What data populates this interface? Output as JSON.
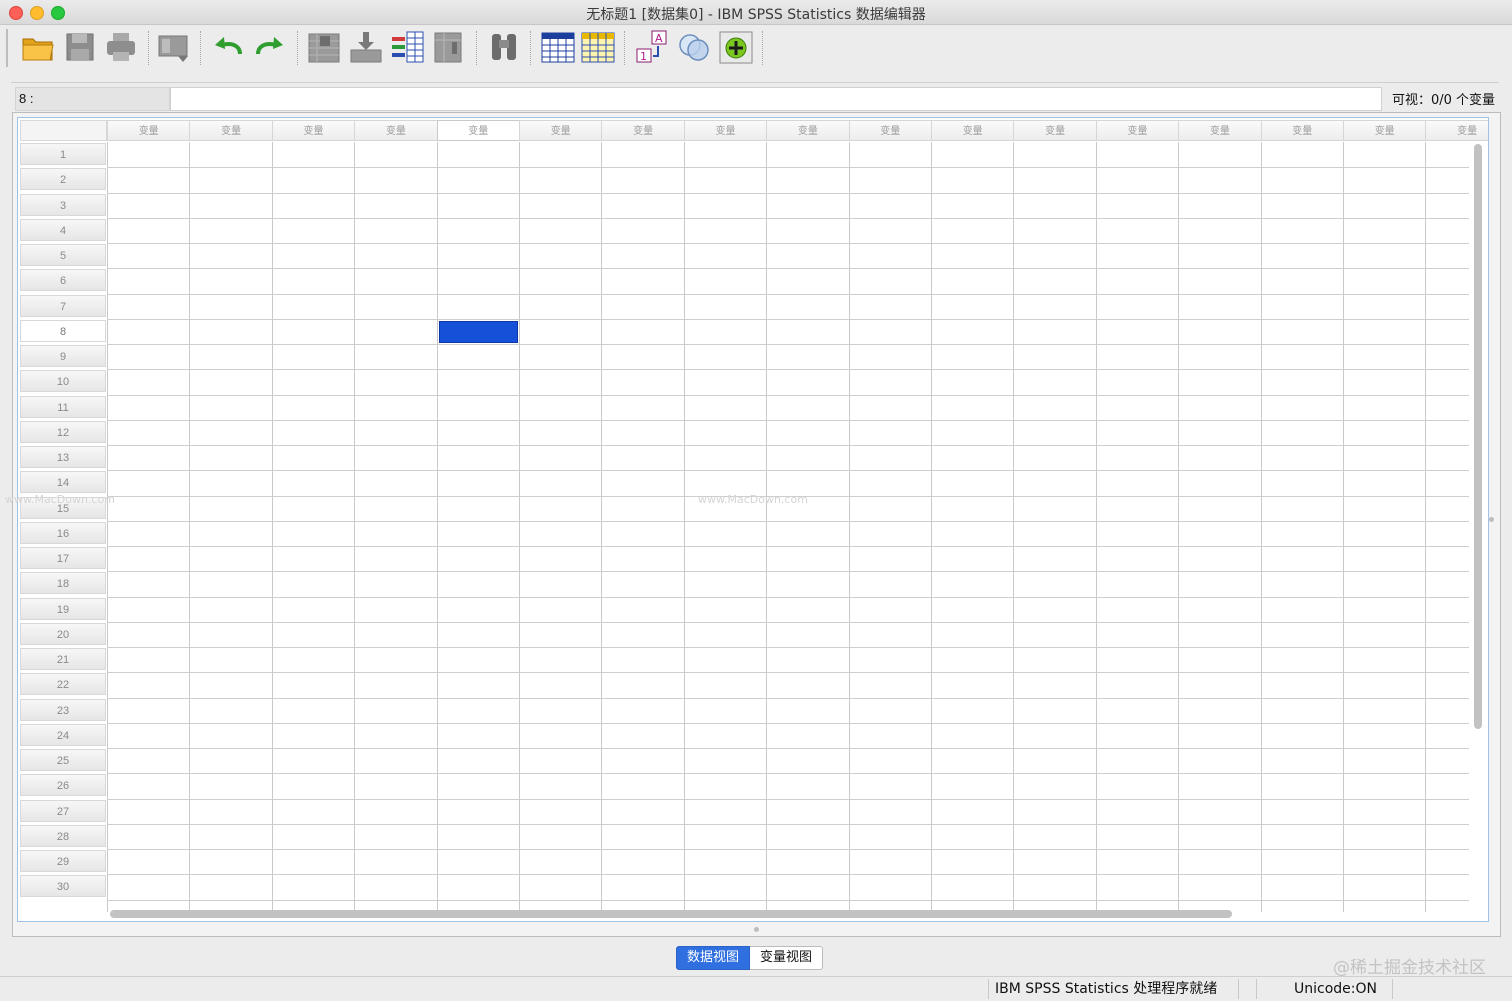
{
  "window": {
    "title": "无标题1 [数据集0] - IBM SPSS Statistics 数据编辑器"
  },
  "toolbar": {
    "buttons": [
      {
        "name": "open-data-document-icon"
      },
      {
        "name": "save-icon"
      },
      {
        "name": "print-icon"
      },
      {
        "name": "recall-dialog-icon"
      },
      {
        "name": "undo-icon"
      },
      {
        "name": "redo-icon"
      },
      {
        "name": "goto-case-icon"
      },
      {
        "name": "goto-variable-icon"
      },
      {
        "name": "variables-icon"
      },
      {
        "name": "run-descriptives-icon"
      },
      {
        "name": "find-icon"
      },
      {
        "name": "insert-cases-icon"
      },
      {
        "name": "insert-variable-icon"
      },
      {
        "name": "split-file-icon"
      },
      {
        "name": "select-cases-icon"
      },
      {
        "name": "value-labels-icon"
      },
      {
        "name": "use-variable-sets-icon"
      }
    ]
  },
  "cell_editor": {
    "reference": "8 :",
    "value": "",
    "visible_label": "可视：0/0 个变量"
  },
  "grid": {
    "column_header_label": "变量",
    "column_count": 17,
    "row_numbers": [
      "1",
      "2",
      "3",
      "4",
      "5",
      "6",
      "7",
      "8",
      "9",
      "10",
      "11",
      "12",
      "13",
      "14",
      "15",
      "16",
      "17",
      "18",
      "19",
      "20",
      "21",
      "22",
      "23",
      "24",
      "25",
      "26",
      "27",
      "28",
      "29",
      "30"
    ],
    "active_row": "8",
    "active_column_index": 5
  },
  "watermark": {
    "text": "www.MacDown.com"
  },
  "tabs": {
    "data_view": "数据视图",
    "variable_view": "变量视图"
  },
  "brandmark": "@稀土掘金技术社区",
  "status": {
    "processor": "IBM SPSS Statistics 处理程序就绪",
    "unicode": "Unicode:ON"
  },
  "colors": {
    "selected_cell": "#1450d8",
    "active_tab": "#2f6fdf"
  }
}
